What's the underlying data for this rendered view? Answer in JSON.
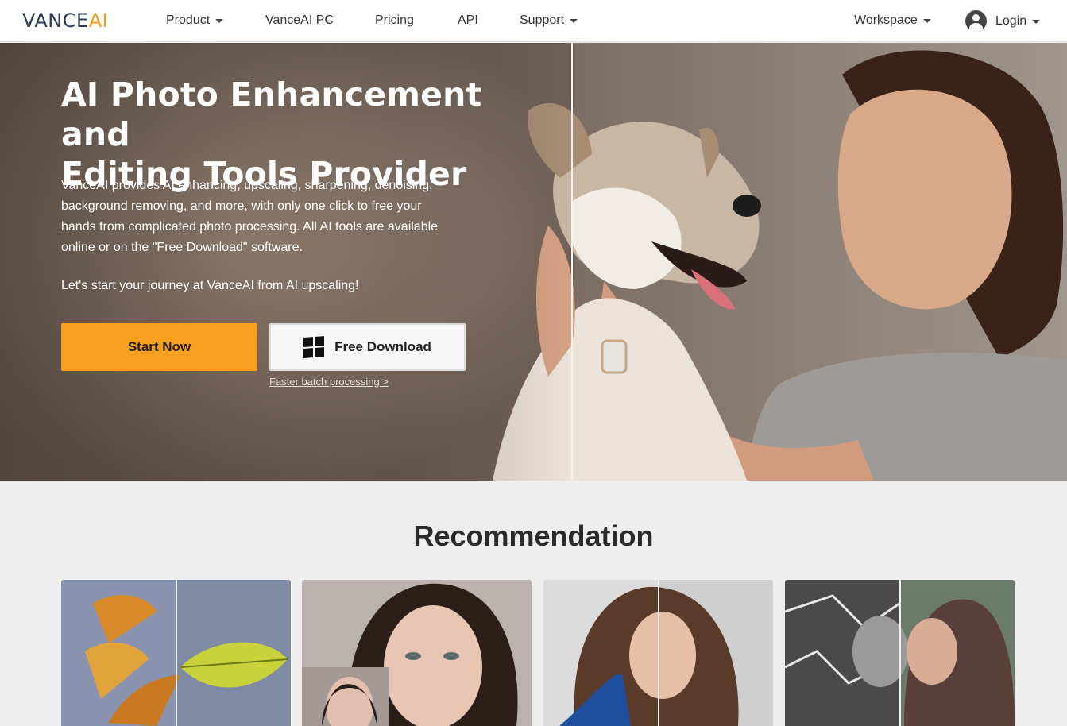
{
  "nav": {
    "logo_part1": "VANCE",
    "logo_part2": "AI",
    "items": [
      "Product",
      "VanceAI PC",
      "Pricing",
      "API",
      "Support"
    ],
    "workspace": "Workspace",
    "login": "Login"
  },
  "hero": {
    "title_line1": "AI Photo Enhancement and",
    "title_line2": "Editing Tools Provider",
    "description": "VanceAI provides AI enhancing, upscaling, sharpening, denoising, background removing, and more, with only one click to free your hands from complicated photo processing. All AI tools are available online or on the \"Free Download\" software.",
    "subline": "Let's start your journey at VanceAI from AI upscaling!",
    "start_button": "Start Now",
    "download_button": "Free Download",
    "batch_link": "Faster batch processing >"
  },
  "recommendation": {
    "title": "Recommendation"
  },
  "colors": {
    "accent": "#f7a01f",
    "logo_dark": "#2d3b55",
    "logo_orange": "#f49b1d"
  }
}
